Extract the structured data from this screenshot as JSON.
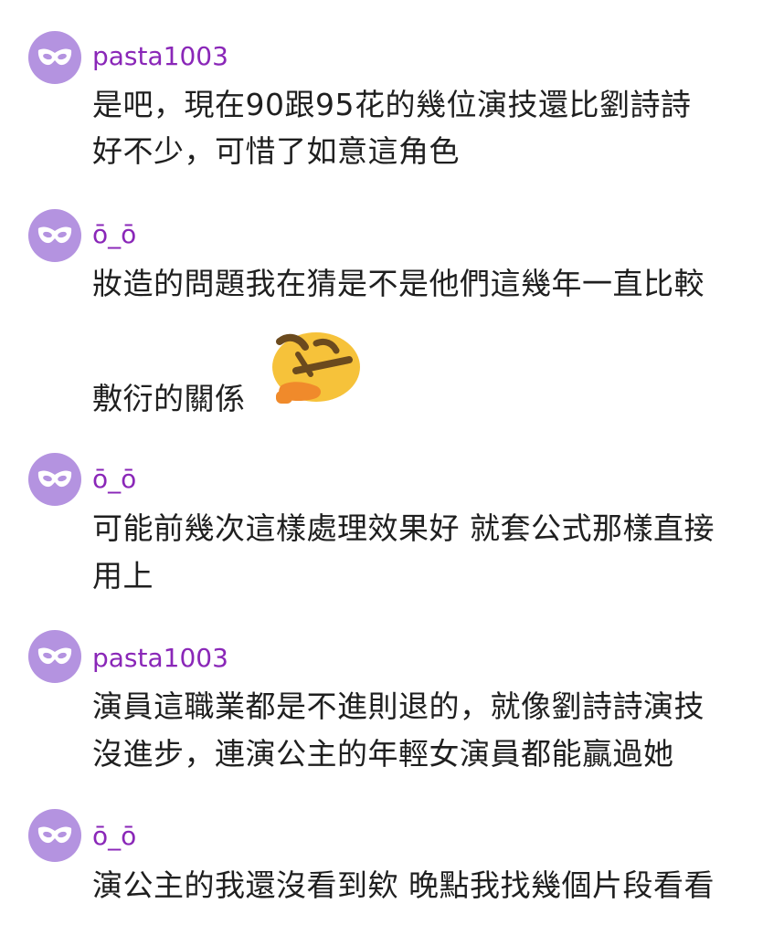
{
  "comments": [
    {
      "username": "pasta1003",
      "lines": [
        "是吧，現在90跟95花的幾位演技還比劉詩詩",
        "好不少，可惜了如意這角色"
      ]
    },
    {
      "username": "ō_ō",
      "lines": [
        "妝造的問題我在猜是不是他們這幾年一直比較",
        "敷衍的關係"
      ],
      "emoji": "thinking-face-sticker"
    },
    {
      "username": "ō_ō",
      "lines": [
        "可能前幾次這樣處理效果好 就套公式那樣直接",
        "用上"
      ]
    },
    {
      "username": "pasta1003",
      "lines": [
        "演員這職業都是不進則退的，就像劉詩詩演技",
        "沒進步，連演公主的年輕女演員都能贏過她"
      ]
    },
    {
      "username": "ō_ō",
      "lines": [
        "演公主的我還沒看到欸 晚點我找幾個片段看看"
      ]
    }
  ],
  "colors": {
    "avatar_bg": "#b493e0",
    "username": "#8a27b8",
    "text": "#1f1f1f",
    "emoji_face": "#f6c23a",
    "emoji_brow": "#6b4a1e",
    "emoji_hand": "#f08a2b"
  },
  "icons": {
    "avatar": "mask-icon"
  }
}
